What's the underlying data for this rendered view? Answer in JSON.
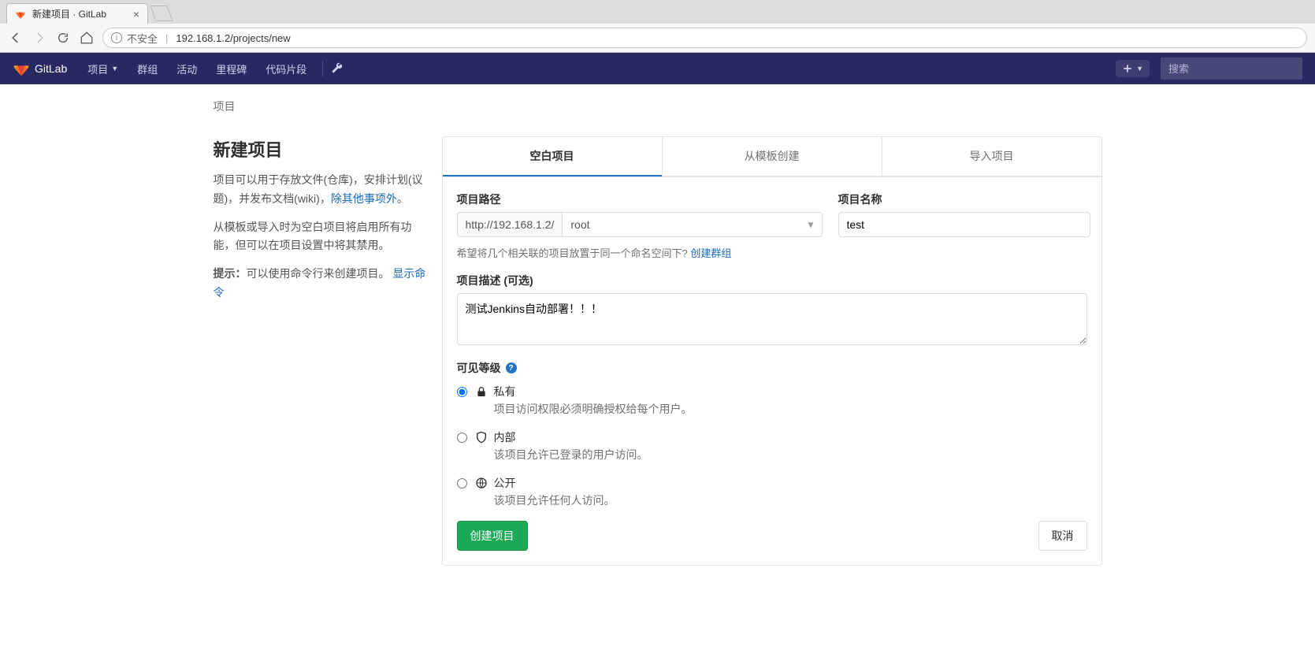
{
  "browser": {
    "tab_title": "新建项目 · GitLab",
    "insecure_label": "不安全",
    "url": "192.168.1.2/projects/new"
  },
  "header": {
    "brand": "GitLab",
    "nav": {
      "projects": "项目",
      "groups": "群组",
      "activity": "活动",
      "milestones": "里程碑",
      "snippets": "代码片段"
    },
    "search_placeholder": "搜索"
  },
  "breadcrumb": "项目",
  "left": {
    "title": "新建项目",
    "desc_part1": "项目可以用于存放文件(仓库)，安排计划(议题)，并发布文档(wiki)，",
    "desc_link": "除其他事项外",
    "desc_period": "。",
    "desc2": "从模板或导入时为空白项目将启用所有功能，但可以在项目设置中将其禁用。",
    "tip_label": "提示：",
    "tip_text": "可以使用命令行来创建项目。 ",
    "tip_link": "显示命令"
  },
  "tabs": {
    "blank": "空白项目",
    "template": "从模板创建",
    "import": "导入项目"
  },
  "form": {
    "path_label": "项目路径",
    "path_prefix": "http://192.168.1.2/",
    "namespace_value": "root",
    "name_label": "项目名称",
    "name_value": "test",
    "path_help": "希望将几个相关联的项目放置于同一个命名空间下?  ",
    "path_help_link": "创建群组",
    "desc_label": "项目描述 (可选)",
    "desc_value": "测试Jenkins自动部署！！！",
    "visibility_label": "可见等级",
    "visibility": {
      "private": {
        "title": "私有",
        "desc": "项目访问权限必须明确授权给每个用户。"
      },
      "internal": {
        "title": "内部",
        "desc": "该项目允许已登录的用户访问。"
      },
      "public": {
        "title": "公开",
        "desc": "该项目允许任何人访问。"
      }
    },
    "submit": "创建项目",
    "cancel": "取消"
  }
}
